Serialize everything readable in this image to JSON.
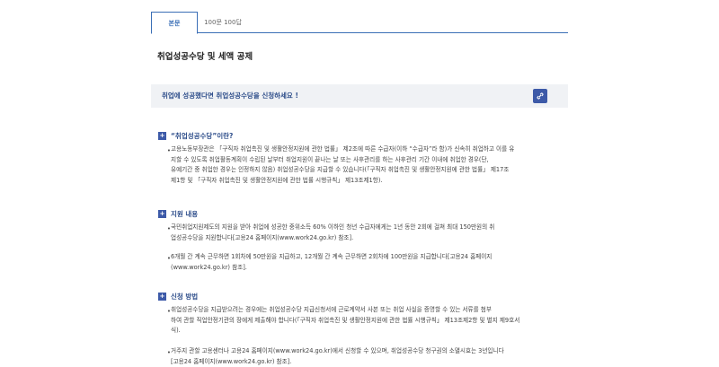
{
  "tabs": [
    {
      "label": "본문"
    },
    {
      "label": "100문 100답"
    }
  ],
  "page_title": "취업성공수당 및 세액 공제",
  "banner": {
    "text": "취업에 성공했다면 취업성공수당을 신청하세요 !",
    "icon": "link-icon"
  },
  "sections": [
    {
      "heading": "“취업성공수당”이란?",
      "paragraphs": [
        {
          "lines": [
            "고용노동부장관은 「구직자 취업촉진 및 생활안정지원에 관한 법률」 제2조에 따른 수급자(이하 “수급자”라 함)가 신속히 취업하고 이를 유",
            "지할 수 있도록 취업활동계획이 수립된 날부터 취업지원이 끝나는 날 또는 사후관리를 하는 사후관리 기간 이내에 취업한 경우(단,",
            "유예기간 중 취업한 경우는 인정하지 않음) 취업성공수당을 지급할 수 있습니다(「구직자 취업촉진 및 생활안정지원에 관한 법률」 제17조",
            "제1항 및 「구직자 취업촉진 및 생활안정지원에 관한 법률 시행규칙」 제13조제1항)."
          ]
        }
      ]
    },
    {
      "heading": "지원 내용",
      "paragraphs": [
        {
          "lines": [
            "국민취업지원제도의 지원을 받아 취업에 성공한 중위소득 60% 이하인 청년 수급자에게는 1년 동안 2회에 걸쳐 최대 150만원의 취",
            "업성공수당을 지원합니다[고용24 홈페이지(www.work24.go.kr) 참조]."
          ]
        },
        {
          "lines": [
            "6개월 간 계속 근무하면 1회차에 50만원을 지급하고, 12개월 간 계속 근무하면 2회차에 100만원을 지급합니다[고용24 홈페이지",
            "(www.work24.go.kr) 참조]."
          ]
        }
      ]
    },
    {
      "heading": "신청 방법",
      "paragraphs": [
        {
          "lines": [
            "취업성공수당을 지급받으려는 경우에는 취업성공수당 지급신청서에 근로계약서 사본 또는 취업 사실을 증명할 수 있는 서류를 첨부",
            "하여 관할 직업안정기관의 장에게 제출해야 합니다(「구직자 취업촉진 및 생활안정지원에 관한 법률 시행규칙」 제13조제2항 및 별지 제9호서",
            "식)."
          ]
        },
        {
          "lines": [
            "거주지 관할 고용센터나 고용24 홈페이지(www.work24.go.kr)에서 신청할 수 있으며, 취업성공수당 청구권의 소멸시효는 3년입니다",
            "[고용24 홈페이지(www.work24.go.kr) 참조]."
          ]
        }
      ]
    }
  ]
}
